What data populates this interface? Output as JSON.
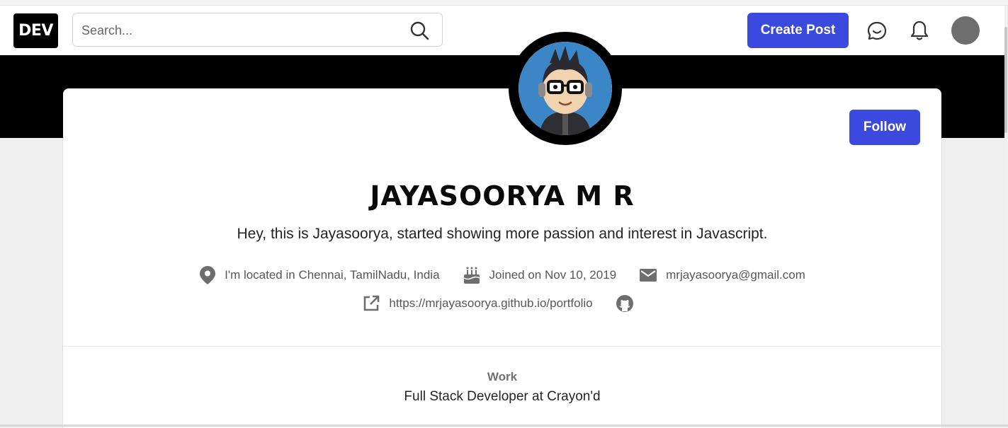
{
  "header": {
    "logo_text": "DEV",
    "search_placeholder": "Search...",
    "create_post_label": "Create Post",
    "accent_color": "#3b49df"
  },
  "profile": {
    "name": "JAYASOORYA M R",
    "bio": "Hey, this is Jayasoorya, started showing more passion and interest in Javascript.",
    "follow_label": "Follow",
    "location": "I'm located in Chennai, TamilNadu, India",
    "joined": "Joined on Nov 10, 2019",
    "email": "mrjayasoorya@gmail.com",
    "website": "https://mrjayasoorya.github.io/portfolio",
    "work_label": "Work",
    "work_value": "Full Stack Developer at Crayon'd"
  },
  "icons": [
    "search-icon",
    "chat-icon",
    "bell-icon",
    "location-pin-icon",
    "cake-icon",
    "mail-icon",
    "external-link-icon",
    "github-icon"
  ]
}
